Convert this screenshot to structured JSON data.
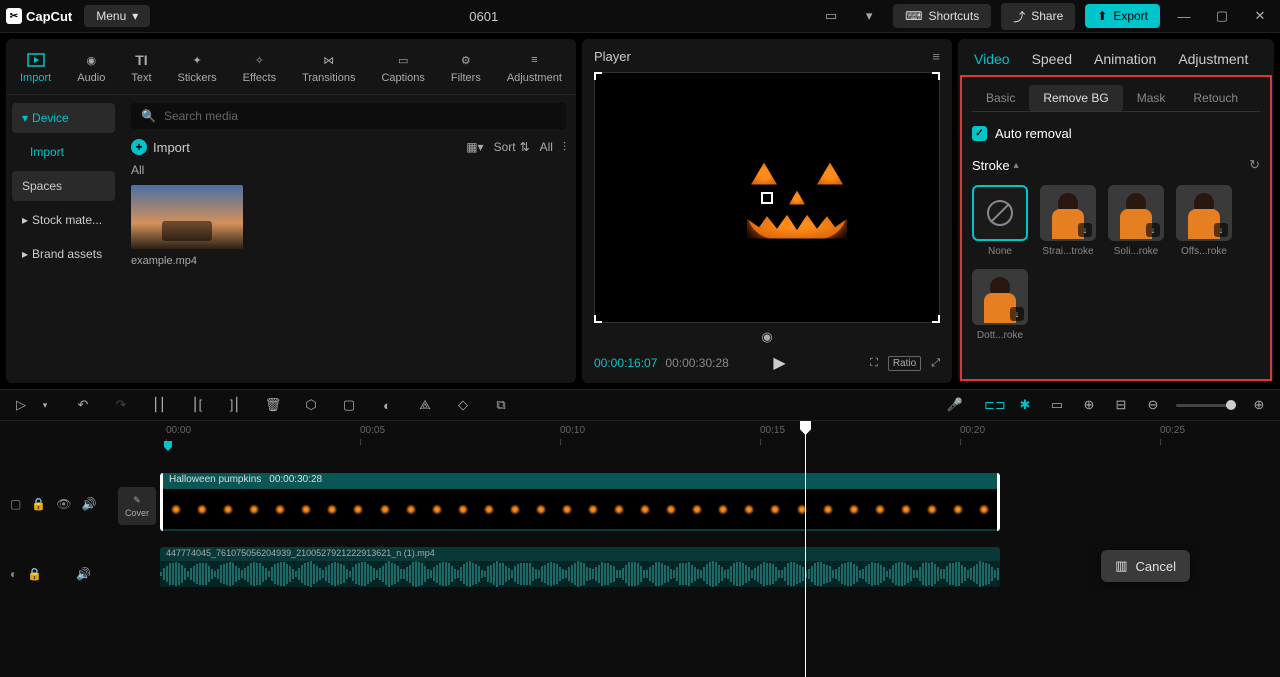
{
  "titlebar": {
    "logo": "CapCut",
    "menu": "Menu",
    "project_name": "0601",
    "shortcuts": "Shortcuts",
    "share": "Share",
    "export": "Export"
  },
  "top_tabs": [
    {
      "label": "Import",
      "active": true
    },
    {
      "label": "Audio"
    },
    {
      "label": "Text"
    },
    {
      "label": "Stickers"
    },
    {
      "label": "Effects"
    },
    {
      "label": "Transitions"
    },
    {
      "label": "Captions"
    },
    {
      "label": "Filters"
    },
    {
      "label": "Adjustment"
    }
  ],
  "left_sidebar": [
    {
      "label": "Device",
      "active": true,
      "expand": true
    },
    {
      "label": "Import",
      "sub": true
    },
    {
      "label": "Spaces"
    },
    {
      "label": "Stock mate...",
      "expand": true
    },
    {
      "label": "Brand assets",
      "expand": true
    }
  ],
  "search": {
    "placeholder": "Search media"
  },
  "import_btn": "Import",
  "view": {
    "sort": "Sort",
    "all": "All"
  },
  "all_label": "All",
  "media_item": "example.mp4",
  "player": {
    "title": "Player",
    "current": "00:00:16:07",
    "total": "00:00:30:28",
    "ratio": "Ratio"
  },
  "right_tabs": [
    {
      "label": "Video",
      "active": true
    },
    {
      "label": "Speed"
    },
    {
      "label": "Animation"
    },
    {
      "label": "Adjustment"
    }
  ],
  "sub_tabs": [
    {
      "label": "Basic"
    },
    {
      "label": "Remove BG",
      "active": true
    },
    {
      "label": "Mask"
    },
    {
      "label": "Retouch"
    }
  ],
  "auto_removal": "Auto removal",
  "stroke_label": "Stroke",
  "stroke_items": [
    {
      "label": "None",
      "none": true,
      "selected": true
    },
    {
      "label": "Strai...troke",
      "dl": true
    },
    {
      "label": "Soli...roke",
      "dl": true
    },
    {
      "label": "Offs...roke",
      "dl": true
    },
    {
      "label": "Dott...roke",
      "dl": true
    }
  ],
  "timeline": {
    "ticks": [
      "00:00",
      "00:05",
      "00:10",
      "00:15",
      "00:20",
      "00:25"
    ],
    "clip_name": "Halloween pumpkins",
    "clip_dur": "00:00:30:28",
    "audio_name": "447774045_761075056204939_2100527921222913621_n (1).mp4",
    "cover": "Cover"
  },
  "cancel": "Cancel"
}
